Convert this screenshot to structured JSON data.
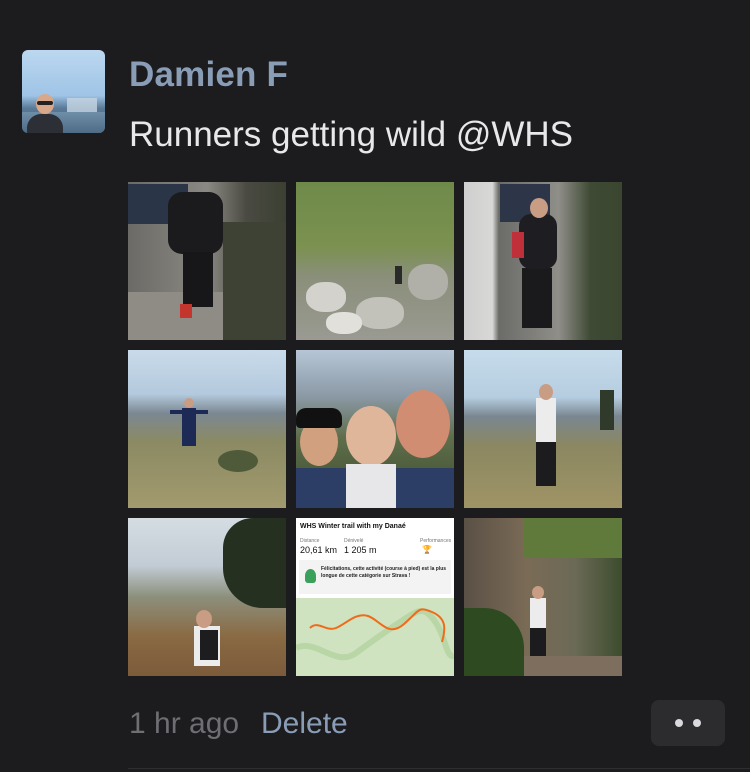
{
  "post": {
    "author": "Damien F",
    "message": "Runners getting wild @WHS",
    "time_ago": "1 hr ago",
    "delete_label": "Delete",
    "more_icon": "more-dots-icon"
  },
  "strava": {
    "title": "WHS Winter trail with my Danaé",
    "distance_label": "Distance",
    "distance_value": "20,61 km",
    "elevation_label": "Dénivelé",
    "elevation_value": "1 205 m",
    "performance_label": "Performances",
    "badge_text": "Félicitations, cette activité (course à pied) est la plus longue de cette catégorie sur Strava !"
  },
  "colors": {
    "background": "#1c1c1e",
    "author": "#8a9db6",
    "message": "#e8e8ea",
    "muted": "#6e6e73"
  }
}
